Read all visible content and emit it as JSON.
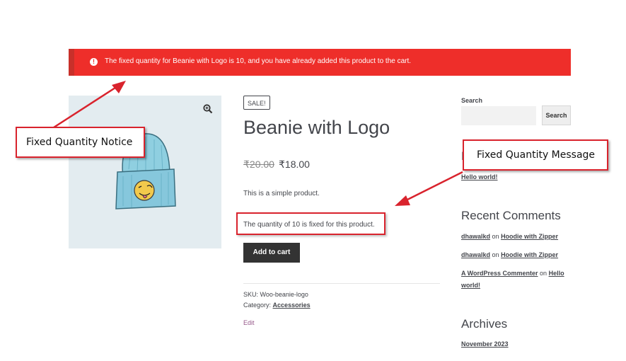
{
  "notice": {
    "icon": "exclamation-icon",
    "text": "The fixed quantity for Beanie with Logo is 10, and you have already added this product to the cart.",
    "color": "#ee2e2a"
  },
  "product": {
    "image_alt": "beanie-with-logo",
    "sale_badge": "SALE!",
    "title": "Beanie with Logo",
    "price_old": "₹20.00",
    "price_new": "₹18.00",
    "short_description": "This is a simple product.",
    "quantity_message": "The quantity of 10 is fixed for this product.",
    "add_to_cart": "Add to cart",
    "sku_label": "SKU:",
    "sku_value": "Woo-beanie-logo",
    "category_label": "Category:",
    "category_value": "Accessories",
    "edit": "Edit"
  },
  "sidebar": {
    "search_label": "Search",
    "search_button": "Search",
    "partial_heading": "R",
    "hello_link": "Hello world!",
    "recent_comments_heading": "Recent Comments",
    "comments": [
      {
        "author": "dhawalkd",
        "on": "on",
        "post": "Hoodie with Zipper"
      },
      {
        "author": "dhawalkd",
        "on": "on",
        "post": "Hoodie with Zipper"
      },
      {
        "author": "A WordPress Commenter",
        "on": "on",
        "post_line1": "Hello",
        "post_line2": "world!"
      }
    ],
    "archives_heading": "Archives",
    "archive_link": "November 2023"
  },
  "callouts": {
    "notice_label": "Fixed Quantity Notice",
    "message_label": "Fixed Quantity Message",
    "color": "#d9232d"
  }
}
